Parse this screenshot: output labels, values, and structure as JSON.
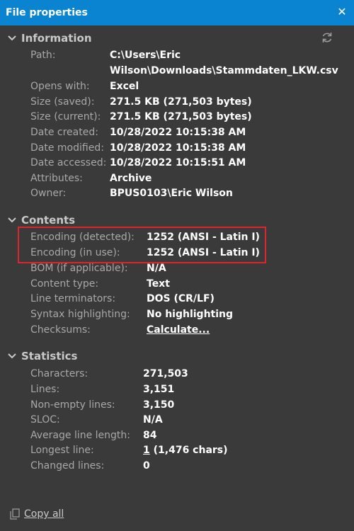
{
  "window": {
    "title": "File properties",
    "close_glyph": "✕"
  },
  "information": {
    "title": "Information",
    "path_label": "Path:",
    "path_line1": "C:\\Users\\Eric",
    "path_line2": "Wilson\\Downloads\\Stammdaten_LKW.csv",
    "opens_with_label": "Opens with:",
    "opens_with": "Excel",
    "size_saved_label": "Size (saved):",
    "size_saved": "271.5 KB (271,503 bytes)",
    "size_current_label": "Size (current):",
    "size_current": "271.5 KB (271,503 bytes)",
    "date_created_label": "Date created:",
    "date_created": "10/28/2022 10:15:38 AM",
    "date_modified_label": "Date modified:",
    "date_modified": "10/28/2022 10:15:38 AM",
    "date_accessed_label": "Date accessed:",
    "date_accessed": "10/28/2022 10:15:51 AM",
    "attributes_label": "Attributes:",
    "attributes": "Archive",
    "owner_label": "Owner:",
    "owner": "BPUS0103\\Eric Wilson"
  },
  "contents": {
    "title": "Contents",
    "enc_detected_label": "Encoding (detected):",
    "enc_detected": "1252  (ANSI - Latin I)",
    "enc_in_use_label": "Encoding (in use):",
    "enc_in_use": "1252  (ANSI - Latin I)",
    "bom_label": "BOM (if applicable):",
    "bom": "N/A",
    "content_type_label": "Content type:",
    "content_type": "Text",
    "line_term_label": "Line terminators:",
    "line_term": "DOS (CR/LF)",
    "syntax_label": "Syntax highlighting:",
    "syntax": "No highlighting",
    "checksums_label": "Checksums:",
    "checksums_link": "Calculate..."
  },
  "statistics": {
    "title": "Statistics",
    "characters_label": "Characters:",
    "characters": "271,503",
    "lines_label": "Lines:",
    "lines": "3,151",
    "nonempty_label": "Non-empty lines:",
    "nonempty": "3,150",
    "sloc_label": "SLOC:",
    "sloc": "N/A",
    "avg_len_label": "Average line length:",
    "avg_len": "84",
    "longest_label": "Longest line:",
    "longest_link": "1",
    "longest_rest": " (1,476 chars)",
    "changed_label": "Changed lines:",
    "changed": "0"
  },
  "footer": {
    "copy_all": "Copy all"
  },
  "colors": {
    "titlebar": "#0a84d0",
    "background": "#3a3a3a",
    "highlight_border": "#e0242c"
  },
  "icons": {
    "section": "chevron-down-icon",
    "refresh": "refresh-icon",
    "copy": "copy-icon",
    "close": "close-icon"
  }
}
